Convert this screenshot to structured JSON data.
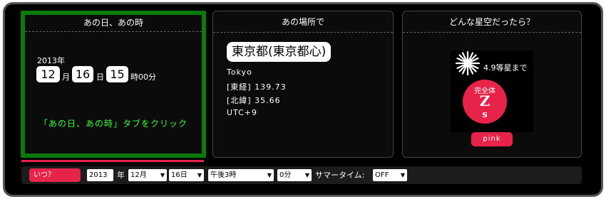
{
  "when_panel": {
    "title": "あの日、あの時",
    "year": "2013年",
    "month": "12",
    "month_label": "月",
    "day": "16",
    "day_label": "日",
    "hour": "15",
    "hour_label": "時00分",
    "hint": "「あの日、あの時」タブをクリック"
  },
  "where_panel": {
    "title": "あの場所で",
    "place": "東京都(東京都心)",
    "city": "Tokyo",
    "longitude": "[東経] 139.73",
    "latitude": "[北緯] 35.66",
    "timezone": "UTC+9"
  },
  "sky_panel": {
    "title": "どんな星空だったら？",
    "magnitude": "4.9等星まで",
    "badge_top": "完全体",
    "badge_main": "Z",
    "badge_sub": "s",
    "color_button": "pink",
    "star_icon": "star-burst-icon"
  },
  "bottom_bar": {
    "itsu_button": "いつ？",
    "year_value": "2013",
    "year_label": "年",
    "month_select": "12月",
    "day_select": "16日",
    "hour_select": "午後3時",
    "minute_select": "0分",
    "summer_label": "サマータイム:",
    "summer_select": "OFF"
  },
  "colors": {
    "accent": "#e8234a",
    "active_border": "#0a7a0a",
    "hint_text": "#33ff33"
  }
}
